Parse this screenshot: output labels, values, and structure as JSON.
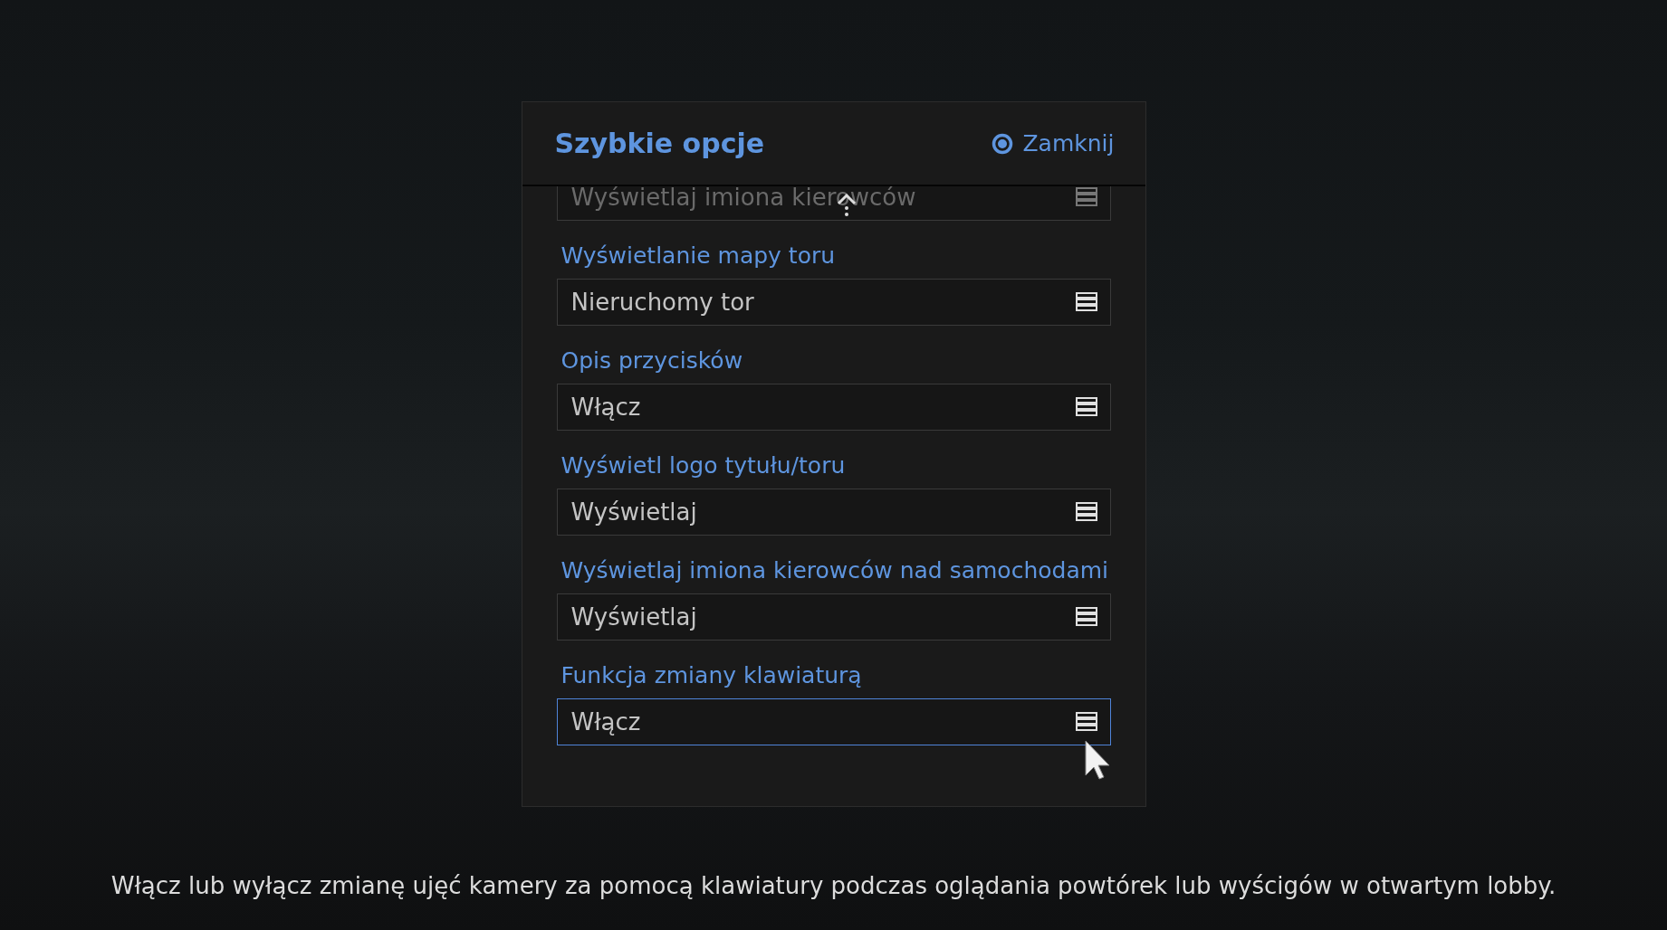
{
  "dialog": {
    "title": "Szybkie opcje",
    "close_button": {
      "label": "Zamknij"
    },
    "scrolled_item": {
      "value": "Wyświetlaj imiona kierowców"
    },
    "options": [
      {
        "label": "Wyświetlanie mapy toru",
        "value": "Nieruchomy tor",
        "selected": false
      },
      {
        "label": "Opis przycisków",
        "value": "Włącz",
        "selected": false
      },
      {
        "label": "Wyświetl logo tytułu/toru",
        "value": "Wyświetlaj",
        "selected": false
      },
      {
        "label": "Wyświetlaj imiona kierowców nad samochodami",
        "value": "Wyświetlaj",
        "selected": false
      },
      {
        "label": "Funkcja zmiany klawiaturą",
        "value": "Włącz",
        "selected": true
      }
    ]
  },
  "description": "Włącz lub wyłącz zmianę ujęć kamery za pomocą klawiatury podczas oglądania powtórek lub wyścigów w otwartym lobby."
}
